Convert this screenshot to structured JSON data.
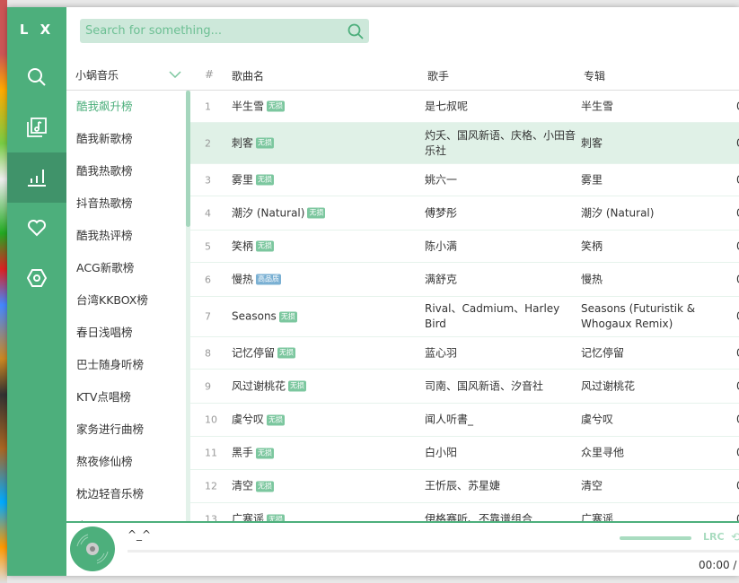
{
  "app": {
    "logo": "L X"
  },
  "nav": [
    {
      "icon": "search-icon"
    },
    {
      "icon": "music-library-icon"
    },
    {
      "icon": "leaderboard-icon",
      "active": true
    },
    {
      "icon": "heart-icon"
    },
    {
      "icon": "settings-icon"
    }
  ],
  "search": {
    "placeholder": "Search for something..."
  },
  "source": {
    "selected": "小蜗音乐"
  },
  "columns": {
    "num": "#",
    "name": "歌曲名",
    "singer": "歌手",
    "album": "专辑"
  },
  "boards": [
    "酷我飙升榜",
    "酷我新歌榜",
    "酷我热歌榜",
    "抖音热歌榜",
    "酷我热评榜",
    "ACG新歌榜",
    "台湾KKBOX榜",
    "春日浅唱榜",
    "巴士随身听榜",
    "KTV点唱榜",
    "家务进行曲榜",
    "熬夜修仙榜",
    "枕边轻音乐榜",
    "小..."
  ],
  "active_board": "酷我飙升榜",
  "songs": [
    {
      "num": "1",
      "name": "半生雪",
      "tag": "无损",
      "singer": "是七叔呢",
      "album": "半生雪",
      "dur": "0"
    },
    {
      "num": "2",
      "name": "刺客",
      "tag": "无损",
      "singer": "灼夭、国风新语、庆格、小田音乐社",
      "album": "刺客",
      "dur": "0"
    },
    {
      "num": "3",
      "name": "雾里",
      "tag": "无损",
      "singer": "姚六一",
      "album": "雾里",
      "dur": "0"
    },
    {
      "num": "4",
      "name": "潮汐 (Natural)",
      "tag": "无损",
      "singer": "傅梦彤",
      "album": "潮汐 (Natural)",
      "dur": "0"
    },
    {
      "num": "5",
      "name": "笑柄",
      "tag": "无损",
      "singer": "陈小满",
      "album": "笑柄",
      "dur": "0"
    },
    {
      "num": "6",
      "name": "慢热",
      "tag": "高品质",
      "singer": "满舒克",
      "album": "慢热",
      "dur": "0"
    },
    {
      "num": "7",
      "name": "Seasons",
      "tag": "无损",
      "singer": "Rival、Cadmium、Harley Bird",
      "album": "Seasons (Futuristik & Whogaux Remix)",
      "dur": "0"
    },
    {
      "num": "8",
      "name": "记忆停留",
      "tag": "无损",
      "singer": "蓝心羽",
      "album": "记忆停留",
      "dur": "0"
    },
    {
      "num": "9",
      "name": "风过谢桃花",
      "tag": "无损",
      "singer": "司南、国风新语、汐音社",
      "album": "风过谢桃花",
      "dur": "0"
    },
    {
      "num": "10",
      "name": "虞兮叹",
      "tag": "无损",
      "singer": "闻人听書_",
      "album": "虞兮叹",
      "dur": "0"
    },
    {
      "num": "11",
      "name": "黑手",
      "tag": "无损",
      "singer": "白小阳",
      "album": "众里寻他",
      "dur": "0"
    },
    {
      "num": "12",
      "name": "清空",
      "tag": "无损",
      "singer": "王忻辰、苏星婕",
      "album": "清空",
      "dur": "0"
    },
    {
      "num": "13",
      "name": "广寒谣",
      "tag": "无损",
      "singer": "伊格赛听、不靠谱组合",
      "album": "广寒谣",
      "dur": "0"
    }
  ],
  "selected_row": "2",
  "player": {
    "title": "^_^",
    "time": "00:00 /",
    "lrc": "LRC",
    "accent": "#4daf7c"
  }
}
